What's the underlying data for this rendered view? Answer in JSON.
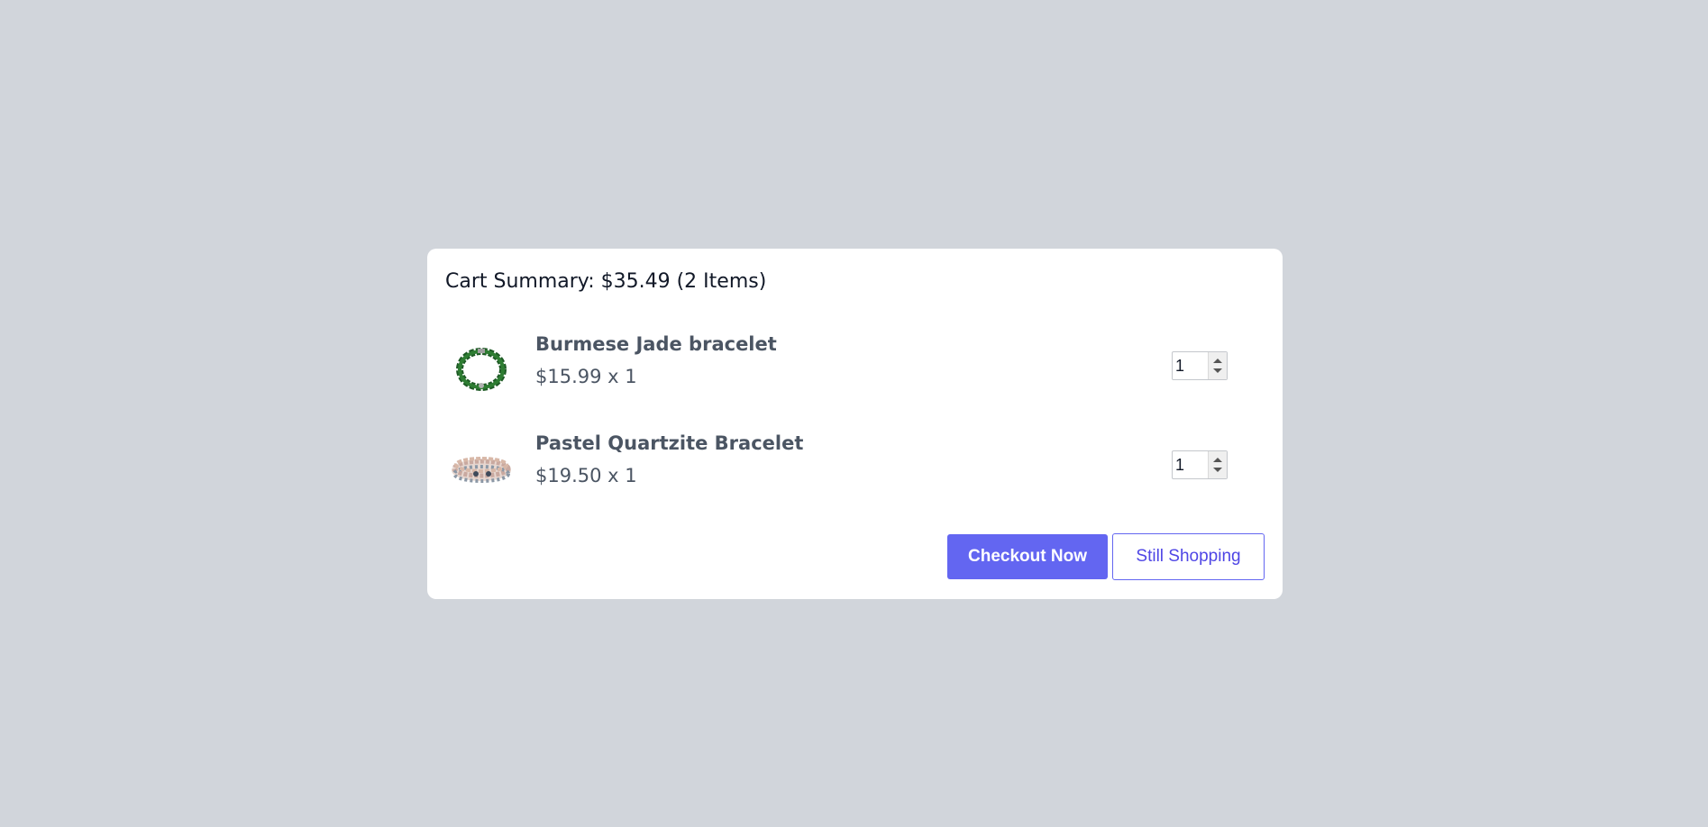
{
  "cart": {
    "title": "Cart Summary: $35.49 (2 Items)",
    "items": [
      {
        "name": "Burmese Jade bracelet",
        "price": "$15.99 x 1",
        "quantity": "1",
        "image_icon": "jade-bracelet-image"
      },
      {
        "name": "Pastel Quartzite Bracelet",
        "price": "$19.50 x 1",
        "quantity": "1",
        "image_icon": "quartzite-bracelet-image"
      }
    ],
    "checkout_label": "Checkout Now",
    "continue_label": "Still Shopping"
  },
  "colors": {
    "background": "#d1d5db",
    "accent": "#6366f1",
    "accent_text": "#4f46e5",
    "item_text": "#4b5563"
  }
}
